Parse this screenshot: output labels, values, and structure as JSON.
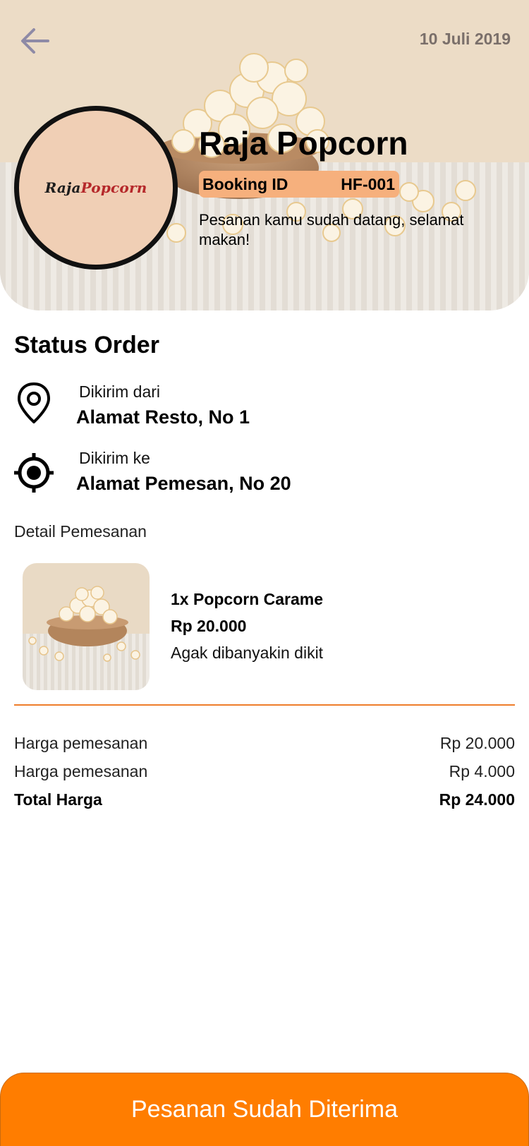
{
  "header": {
    "date": "10 Juli 2019",
    "store_name": "Raja Popcorn",
    "logo": {
      "part1": "Raja",
      "part2": "Popcorn"
    },
    "booking": {
      "label": "Booking ID",
      "id": "HF-001"
    },
    "message": "Pesanan kamu sudah datang, selamat makan!"
  },
  "status": {
    "title": "Status Order",
    "from": {
      "label": "Dikirim dari",
      "value": "Alamat Resto, No 1",
      "icon": "map-pin-icon"
    },
    "to": {
      "label": "Dikirim ke",
      "value": "Alamat Pemesan, No 20",
      "icon": "crosshair-icon"
    }
  },
  "detail": {
    "heading": "Detail Pemesanan",
    "item": {
      "name": "1x Popcorn Carame",
      "price": "Rp 20.000",
      "note": "Agak dibanyakin dikit"
    }
  },
  "summary": {
    "rows": [
      {
        "label": "Harga pemesanan",
        "value": "Rp 20.000"
      },
      {
        "label": "Harga pemesanan",
        "value": "Rp 4.000"
      }
    ],
    "total": {
      "label": "Total Harga",
      "value": "Rp 24.000"
    }
  },
  "action": {
    "label": "Pesanan Sudah Diterima"
  },
  "colors": {
    "accent": "#ff7d00",
    "divider": "#ee7d2b",
    "pill": "#f6b07d",
    "logo_bg": "#f0cfb5",
    "logo_red": "#b5282a"
  }
}
